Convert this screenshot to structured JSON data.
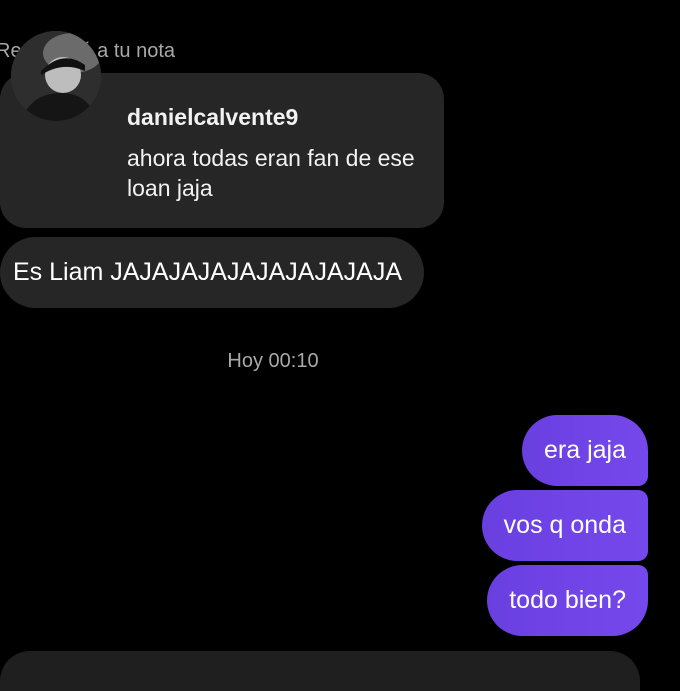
{
  "note_reply": {
    "caption": "Respondió a tu nota",
    "username": "danielcalvente9",
    "note_text": "ahora todas eran fan de ese loan jaja"
  },
  "messages": {
    "incoming": [
      {
        "text": "Es Liam JAJAJAJAJAJAJAJAJAJA"
      }
    ],
    "timestamp": "Hoy 00:10",
    "outgoing": [
      {
        "text": "era jaja"
      },
      {
        "text": "vos q onda"
      },
      {
        "text": "todo bien?"
      }
    ]
  },
  "colors": {
    "background": "#000000",
    "incoming_bubble": "#262626",
    "outgoing_bubble": "#7548ec",
    "muted_text": "#a8a8a8"
  },
  "icons": {
    "avatar": "profile-photo-avatar"
  }
}
